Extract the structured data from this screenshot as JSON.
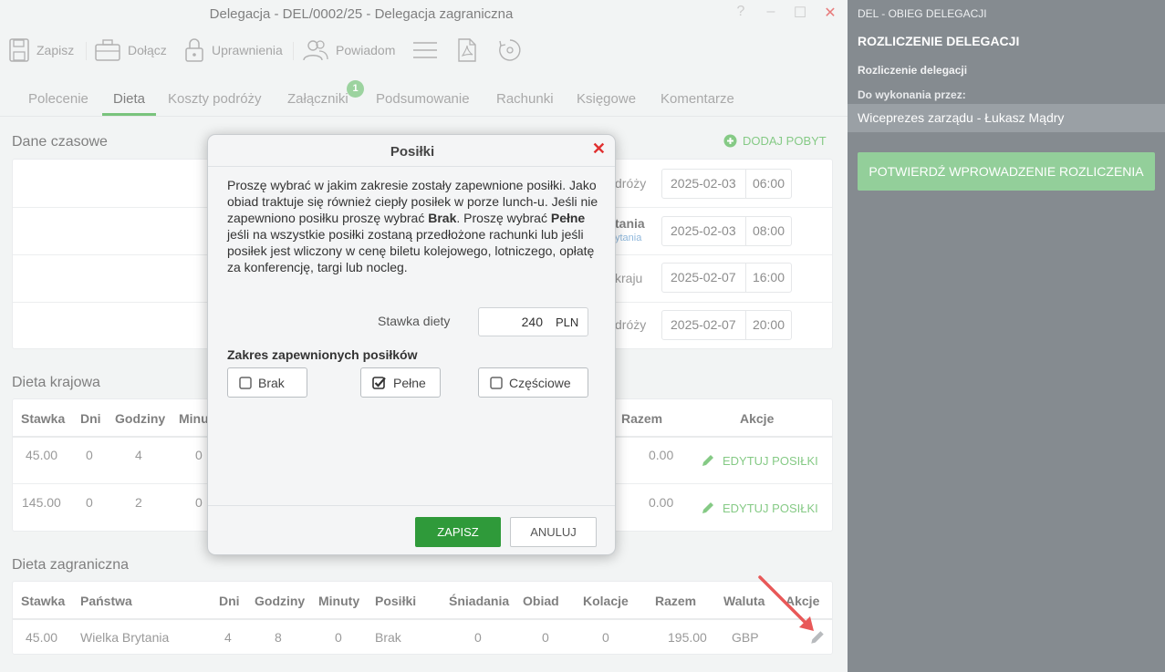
{
  "window": {
    "title": "Delegacja - DEL/0002/25 - Delegacja zagraniczna",
    "help": "?",
    "minimize": "–",
    "maximize": "☐",
    "close": "✕"
  },
  "toolbar": {
    "save": "Zapisz",
    "attach": "Dołącz",
    "permissions": "Uprawnienia",
    "notify": "Powiadom"
  },
  "tabs": [
    "Polecenie",
    "Dieta",
    "Koszty podróży",
    "Załączniki",
    "Podsumowanie",
    "Rachunki",
    "Księgowe",
    "Komentarze"
  ],
  "tab_badge": "1",
  "dane_czasowe": {
    "title": "Dane czasowe",
    "add_stay": "DODAJ POBYT",
    "rows": [
      {
        "label": "dróży",
        "sub": "",
        "date": "2025-02-03",
        "time": "06:00"
      },
      {
        "label": "tania",
        "sub": "ytania",
        "date": "2025-02-03",
        "time": "08:00"
      },
      {
        "label": "kraju",
        "sub": "",
        "date": "2025-02-07",
        "time": "16:00"
      },
      {
        "label": "dróży",
        "sub": "",
        "date": "2025-02-07",
        "time": "20:00"
      }
    ]
  },
  "dieta_krajowa": {
    "title": "Dieta krajowa",
    "headers": {
      "stawka": "Stawka",
      "dni": "Dni",
      "godziny": "Godziny",
      "minuty": "Minu",
      "razem": "Razem",
      "akcje": "Akcje"
    },
    "rows": [
      {
        "stawka": "45.00",
        "dni": "0",
        "godziny": "4",
        "minuty": "0",
        "razem": "0.00",
        "action": "EDYTUJ POSIŁKI"
      },
      {
        "stawka": "145.00",
        "dni": "0",
        "godziny": "2",
        "minuty": "0",
        "razem": "0.00",
        "action": "EDYTUJ POSIŁKI"
      }
    ]
  },
  "dieta_zagraniczna": {
    "title": "Dieta zagraniczna",
    "headers": [
      "Stawka",
      "Państwa",
      "Dni",
      "Godziny",
      "Minuty",
      "Posiłki",
      "Śniadania",
      "Obiad",
      "Kolacje",
      "Razem",
      "Waluta",
      "Akcje"
    ],
    "row": [
      "45.00",
      "Wielka Brytania",
      "4",
      "8",
      "0",
      "Brak",
      "0",
      "0",
      "0",
      "195.00",
      "GBP"
    ]
  },
  "sidebar": {
    "workflow": "DEL - OBIEG DELEGACJI",
    "heading": "ROZLICZENIE DELEGACJI",
    "step": "Rozliczenie delegacji",
    "assignee_label": "Do wykonania przez:",
    "assignee": "Wiceprezes zarządu - Łukasz Mądry",
    "confirm": "POTWIERDŹ WPROWADZENIE ROZLICZENIA"
  },
  "modal": {
    "title": "Posiłki",
    "close": "✕",
    "p1": "Proszę wybrać w jakim zakresie zostały zapewnione posiłki. Jako obiad traktuje się również ciepły posiłek w porze lunch-u. Jeśli nie zapewniono posiłku proszę wybrać ",
    "b1": "Brak",
    "p2": ". Proszę wybrać ",
    "b2": "Pełne",
    "p3": " jeśli na wszystkie posiłki zostaną przedłożone rachunki lub jeśli posiłek jest wliczony w cenę biletu kolejowego, lotniczego, opłatę za konferencję, targi lub nocleg.",
    "rate_label": "Stawka diety",
    "rate_value": "240",
    "rate_unit": "PLN",
    "scope_label": "Zakres zapewnionych posiłków",
    "options": [
      {
        "label": "Brak",
        "checked": false
      },
      {
        "label": "Pełne",
        "checked": true
      },
      {
        "label": "Częściowe",
        "checked": false
      }
    ],
    "save": "ZAPISZ",
    "cancel": "ANULUJ"
  },
  "colors": {
    "accent_green": "#4caf50",
    "save_green": "#2f9a3a",
    "close_red": "#e03030",
    "sidebar_bg": "#858b90",
    "annotation_arrow": "#e02020"
  }
}
